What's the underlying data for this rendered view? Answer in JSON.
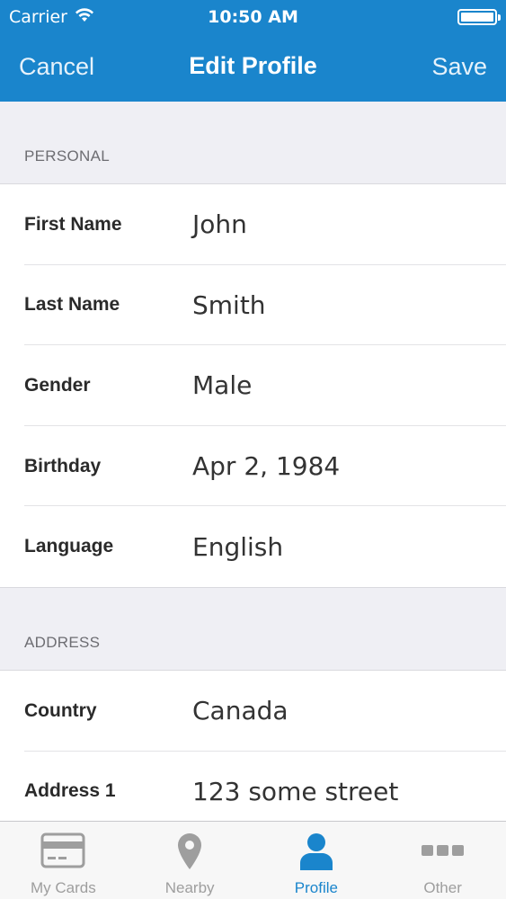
{
  "status_bar": {
    "carrier": "Carrier",
    "time": "10:50 AM"
  },
  "nav": {
    "cancel_label": "Cancel",
    "title": "Edit Profile",
    "save_label": "Save"
  },
  "sections": {
    "personal": {
      "header": "PERSONAL",
      "rows": [
        {
          "label": "First Name",
          "value": "John"
        },
        {
          "label": "Last Name",
          "value": "Smith"
        },
        {
          "label": "Gender",
          "value": "Male"
        },
        {
          "label": "Birthday",
          "value": "Apr 2, 1984"
        },
        {
          "label": "Language",
          "value": "English"
        }
      ]
    },
    "address": {
      "header": "ADDRESS",
      "rows": [
        {
          "label": "Country",
          "value": "Canada"
        },
        {
          "label": "Address 1",
          "value": "123 some street"
        }
      ]
    }
  },
  "tab_bar": {
    "tabs": [
      {
        "label": "My Cards",
        "icon": "card-icon"
      },
      {
        "label": "Nearby",
        "icon": "location-pin-icon"
      },
      {
        "label": "Profile",
        "icon": "person-icon",
        "active": true
      },
      {
        "label": "Other",
        "icon": "more-dots-icon"
      }
    ]
  },
  "colors": {
    "accent": "#1a85cc",
    "inactive_tab": "#9e9e9e",
    "background": "#efeff4"
  }
}
